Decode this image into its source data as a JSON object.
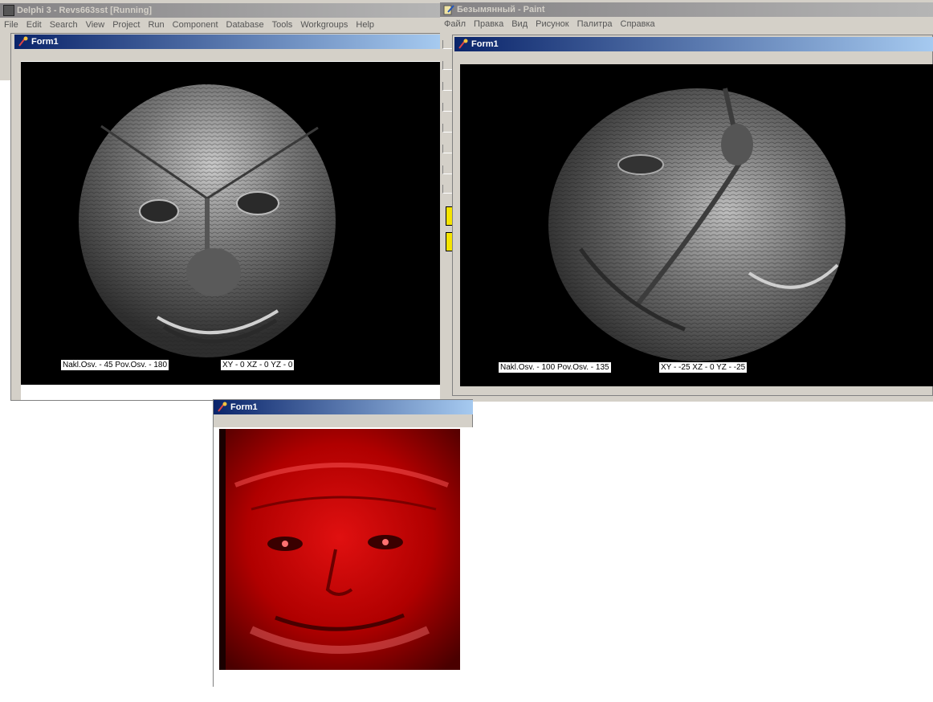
{
  "delphi": {
    "title": "Delphi 3 - Revs663sst [Running]",
    "menu": [
      "File",
      "Edit",
      "Search",
      "View",
      "Project",
      "Run",
      "Component",
      "Database",
      "Tools",
      "Workgroups",
      "Help"
    ]
  },
  "paint": {
    "title": "Безымянный - Paint",
    "menu": [
      "Файл",
      "Правка",
      "Вид",
      "Рисунок",
      "Палитра",
      "Справка"
    ]
  },
  "form_left": {
    "title": "Form1",
    "status_left": "Nakl.Osv. - 45   Pov.Osv. - 180",
    "status_right": "XY - 0   XZ - 0   YZ - 0"
  },
  "form_right": {
    "title": "Form1",
    "status_left": "Nakl.Osv. - 100   Pov.Osv. - 135",
    "status_right": "XY - -25   XZ - 0   YZ - -25"
  },
  "form_bottom": {
    "title": "Form1"
  },
  "colors": {
    "active_title": "#0a246a",
    "inactive_title": "#848284",
    "face_tint": "#c00000"
  }
}
